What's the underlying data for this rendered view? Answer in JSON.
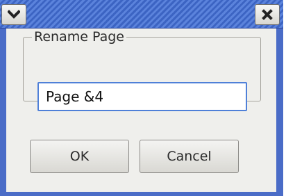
{
  "window": {
    "menu_icon": "chevron-down-icon",
    "close_icon": "close-icon"
  },
  "group": {
    "legend": "Rename Page"
  },
  "input": {
    "value": "Page &4"
  },
  "buttons": {
    "ok": "OK",
    "cancel": "Cancel"
  },
  "colors": {
    "titlebar": "#4a6cc7",
    "dialog_bg": "#efefec",
    "input_focus_border": "#4f80d8"
  }
}
